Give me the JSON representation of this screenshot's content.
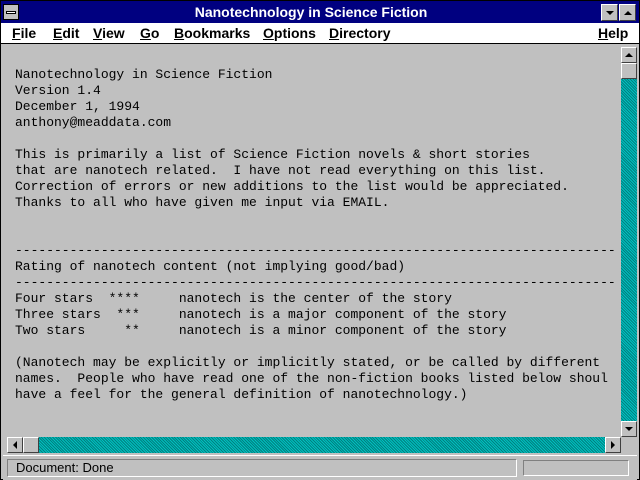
{
  "window": {
    "title": "Nanotechnology in Science Fiction"
  },
  "menu": {
    "items": [
      {
        "label": "File"
      },
      {
        "label": "Edit"
      },
      {
        "label": "View"
      },
      {
        "label": "Go"
      },
      {
        "label": "Bookmarks"
      },
      {
        "label": "Options"
      },
      {
        "label": "Directory"
      },
      {
        "label": "Help"
      }
    ]
  },
  "document": {
    "lines": [
      "Nanotechnology in Science Fiction",
      "Version 1.4",
      "December 1, 1994",
      "anthony@meaddata.com",
      "",
      "This is primarily a list of Science Fiction novels & short stories",
      "that are nanotech related.  I have not read everything on this list.",
      "Correction of errors or new additions to the list would be appreciated.",
      "Thanks to all who have given me input via EMAIL.",
      "",
      "",
      "-----------------------------------------------------------------------------",
      "Rating of nanotech content (not implying good/bad)",
      "-----------------------------------------------------------------------------",
      "Four stars  ****     nanotech is the center of the story",
      "Three stars  ***     nanotech is a major component of the story",
      "Two stars     **     nanotech is a minor component of the story",
      "",
      "(Nanotech may be explicitly or implicitly stated, or be called by different",
      "names.  People who have read one of the non-fiction books listed below shoul",
      "have a feel for the general definition of nanotechnology.)"
    ]
  },
  "status": {
    "text": "Document: Done"
  },
  "icons": {
    "system_menu": "system-menu-icon",
    "minimize": "minimize-icon",
    "maximize": "maximize-icon",
    "scroll_up": "arrow-up-icon",
    "scroll_down": "arrow-down-icon",
    "scroll_left": "arrow-left-icon",
    "scroll_right": "arrow-right-icon"
  },
  "colors": {
    "titlebar": "#000080",
    "background": "#c0c0c0",
    "scrollbar_track": "#00a8a8"
  }
}
